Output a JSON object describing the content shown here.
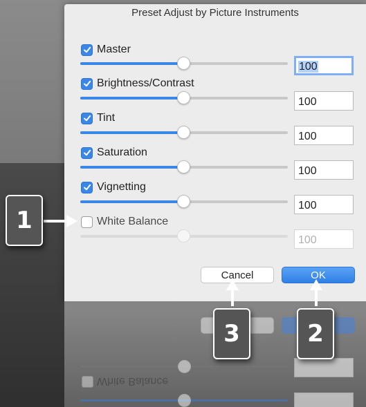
{
  "dialog": {
    "title": "Preset Adjust by Picture Instruments",
    "rows": [
      {
        "label": "Master",
        "checked": true,
        "value": "100",
        "slider_percent": 50,
        "enabled": true
      },
      {
        "label": "Brightness/Contrast",
        "checked": true,
        "value": "100",
        "slider_percent": 50,
        "enabled": true
      },
      {
        "label": "Tint",
        "checked": true,
        "value": "100",
        "slider_percent": 50,
        "enabled": true
      },
      {
        "label": "Saturation",
        "checked": true,
        "value": "100",
        "slider_percent": 50,
        "enabled": true
      },
      {
        "label": "Vignetting",
        "checked": true,
        "value": "100",
        "slider_percent": 50,
        "enabled": true
      },
      {
        "label": "White Balance",
        "checked": false,
        "value": "100",
        "slider_percent": 50,
        "enabled": false
      }
    ],
    "buttons": {
      "cancel_label": "Cancel",
      "ok_label": "OK"
    }
  },
  "reflection": {
    "white_balance_label": "White Balance"
  },
  "callouts": [
    "1",
    "2",
    "3"
  ],
  "colors": {
    "accent": "#3a87e8",
    "callout_bg": "#555555",
    "dialog_bg": "#ececec"
  }
}
